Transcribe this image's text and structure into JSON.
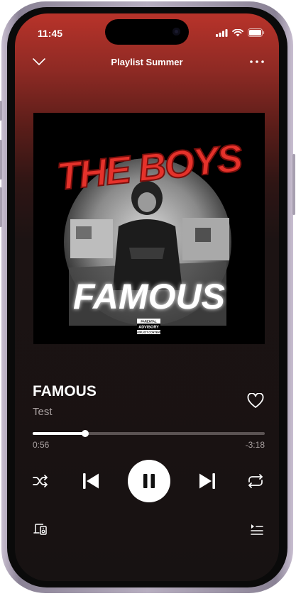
{
  "status_bar": {
    "time": "11:45"
  },
  "header": {
    "title": "Playlist Summer"
  },
  "album_art": {
    "cover_text": "FAMOUS",
    "graffiti_text": "THE BOYS",
    "advisory_line1": "PARENTAL",
    "advisory_line2": "ADVISORY",
    "advisory_line3": "EXPLICIT CONTENT"
  },
  "track": {
    "title": "FAMOUS",
    "artist": "Test"
  },
  "playback": {
    "elapsed": "0:56",
    "remaining": "-3:18",
    "progress": 0.227
  },
  "colors": {
    "accent_top": "#b8332a",
    "background": "#171212",
    "graffiti_red": "#e5322b"
  },
  "icons": [
    "chevron-down-icon",
    "more-icon",
    "heart-icon",
    "shuffle-icon",
    "previous-icon",
    "pause-icon",
    "next-icon",
    "repeat-icon",
    "devices-icon",
    "queue-icon",
    "signal-icon",
    "wifi-icon",
    "battery-icon"
  ]
}
